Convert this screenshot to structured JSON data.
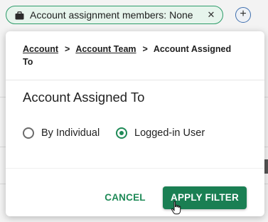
{
  "filter_chip": {
    "label": "Account assignment members: None",
    "icon": "briefcase-icon",
    "close_glyph": "✕"
  },
  "add_filter": {
    "glyph": "+"
  },
  "modal": {
    "breadcrumb": {
      "items": [
        "Account",
        "Account Team"
      ],
      "separator": ">",
      "current": "Account Assigned To"
    },
    "title": "Account Assigned To",
    "options": [
      {
        "label": "By Individual",
        "selected": false
      },
      {
        "label": "Logged-in User",
        "selected": true
      }
    ],
    "cancel_label": "CANCEL",
    "apply_label": "APPLY FILTER"
  },
  "colors": {
    "accent": "#1a7f53",
    "chip_border": "#2e9c6a",
    "chip_bg": "#e6f4ec"
  }
}
